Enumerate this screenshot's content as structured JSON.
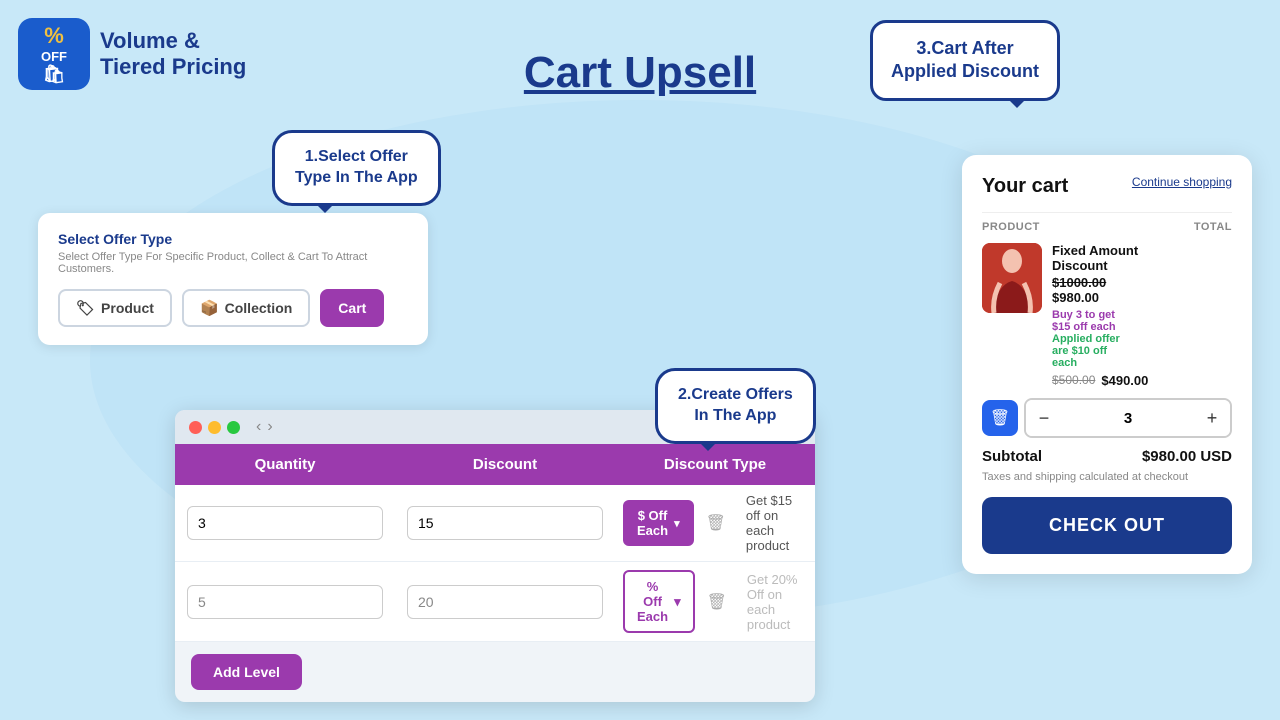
{
  "app": {
    "logo": {
      "percent": "%",
      "off": "OFF",
      "title_line1": "Volume &",
      "title_line2": "Tiered Pricing"
    }
  },
  "page": {
    "title": "Cart Upsell"
  },
  "bubble_top_right": {
    "text": "3.Cart After\nApplied Discount"
  },
  "bubble_select": {
    "text": "1.Select Offer\nType In The App"
  },
  "bubble_create": {
    "text": "2.Create Offers\nIn The App"
  },
  "offer_type_panel": {
    "label": "Select Offer Type",
    "desc": "Select Offer Type For Specific Product, Collect & Cart To Attract Customers.",
    "buttons": [
      {
        "id": "product",
        "label": "Product",
        "icon": "🏷️",
        "active": false
      },
      {
        "id": "collection",
        "label": "Collection",
        "icon": "📦",
        "active": false
      },
      {
        "id": "cart",
        "label": "Cart",
        "active": true
      }
    ]
  },
  "offer_window": {
    "table_headers": [
      "Quantity",
      "Discount",
      "Discount Type"
    ],
    "rows": [
      {
        "quantity": "3",
        "discount": "15",
        "discount_type": "$ Off Each",
        "description": "Get $15 off on each product",
        "active": true
      },
      {
        "quantity": "5",
        "discount": "20",
        "discount_type": "% Off Each",
        "description": "Get 20% Off on each product",
        "active": false
      }
    ],
    "add_level_label": "Add Level"
  },
  "cart_panel": {
    "title": "Your cart",
    "continue_shopping": "Continue shopping",
    "col_product": "PRODUCT",
    "col_total": "TOTAL",
    "item": {
      "name": "Fixed Amount\nDiscount",
      "original_price": "$1000.00",
      "discounted_price": "$980.00",
      "promo_text": "Buy 3 to get\n$15 off each",
      "applied_text": "Applied offer\nare $10 off\neach",
      "price_strike": "$500.00",
      "price_final": "$490.00"
    },
    "quantity": 3,
    "subtotal_label": "Subtotal",
    "subtotal_value": "$980.00 USD",
    "tax_note": "Taxes and shipping calculated at checkout",
    "checkout_label": "CHECK OUT"
  }
}
